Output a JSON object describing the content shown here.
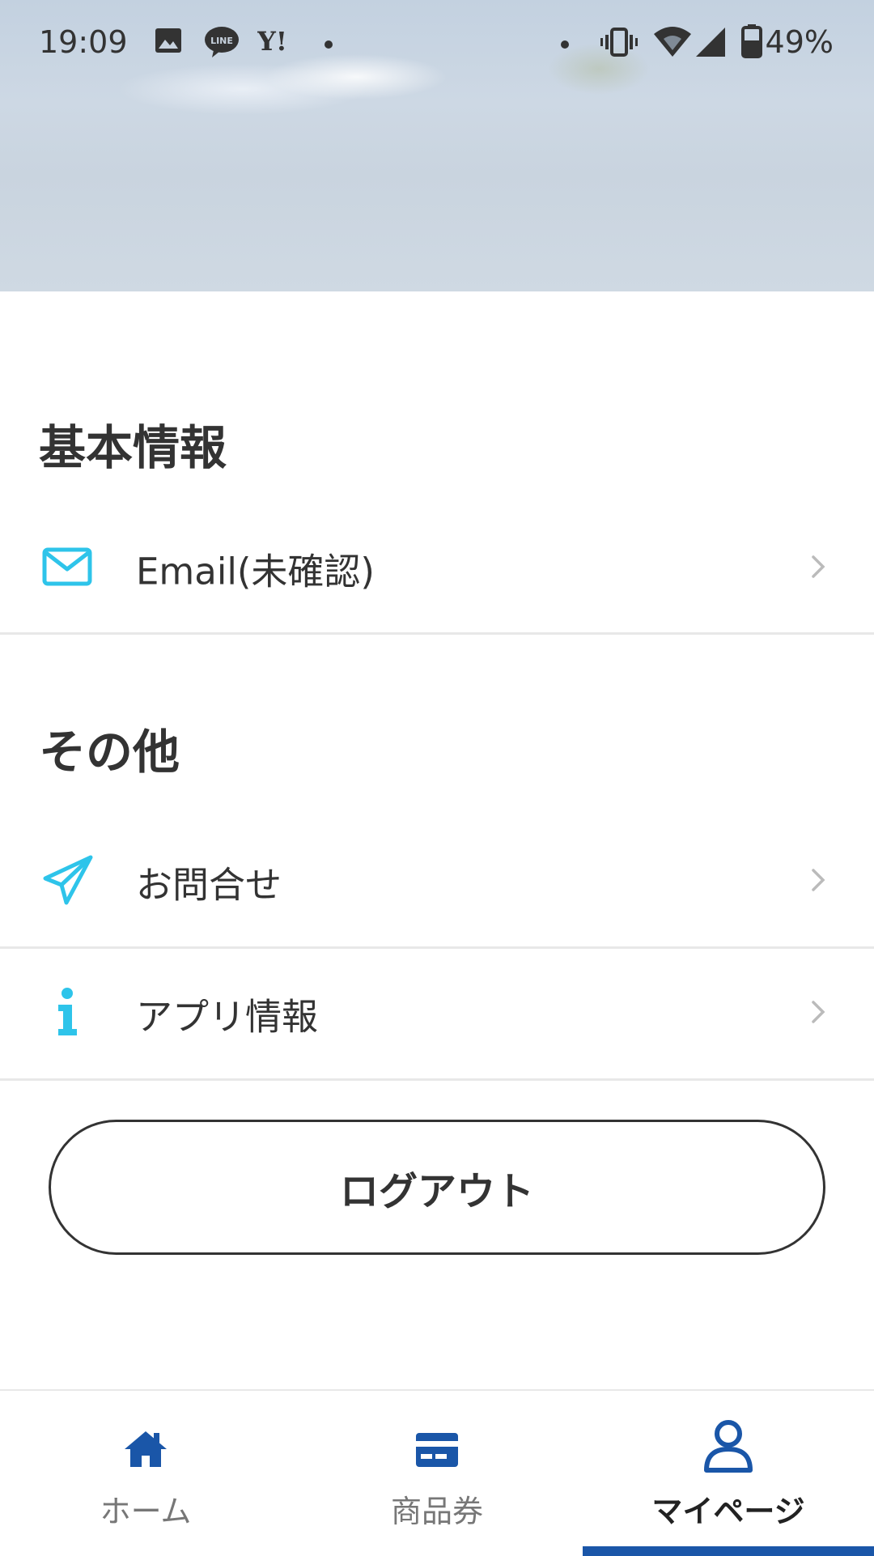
{
  "status_bar": {
    "time": "19:09",
    "battery": "49%",
    "left_icons": [
      "image-icon",
      "line-icon",
      "yahoo-icon",
      "dot-icon"
    ],
    "right_icons": [
      "dot-icon",
      "vibrate-icon",
      "wifi-icon",
      "signal-icon",
      "battery-icon"
    ]
  },
  "sections": {
    "basic_info": {
      "title": "基本情報",
      "items": [
        {
          "label": "Email(未確認)",
          "icon": "mail-icon"
        }
      ]
    },
    "other": {
      "title": "その他",
      "items": [
        {
          "label": "お問合せ",
          "icon": "paper-plane-icon"
        },
        {
          "label": "アプリ情報",
          "icon": "info-icon"
        }
      ]
    }
  },
  "logout_label": "ログアウト",
  "bottom_nav": {
    "items": [
      {
        "label": "ホーム",
        "icon": "home-icon",
        "active": false
      },
      {
        "label": "商品券",
        "icon": "voucher-card-icon",
        "active": false
      },
      {
        "label": "マイページ",
        "icon": "user-icon",
        "active": true
      }
    ]
  },
  "colors": {
    "accent_cyan": "#2ec4ea",
    "nav_blue": "#1a56a8",
    "text": "#333333"
  }
}
